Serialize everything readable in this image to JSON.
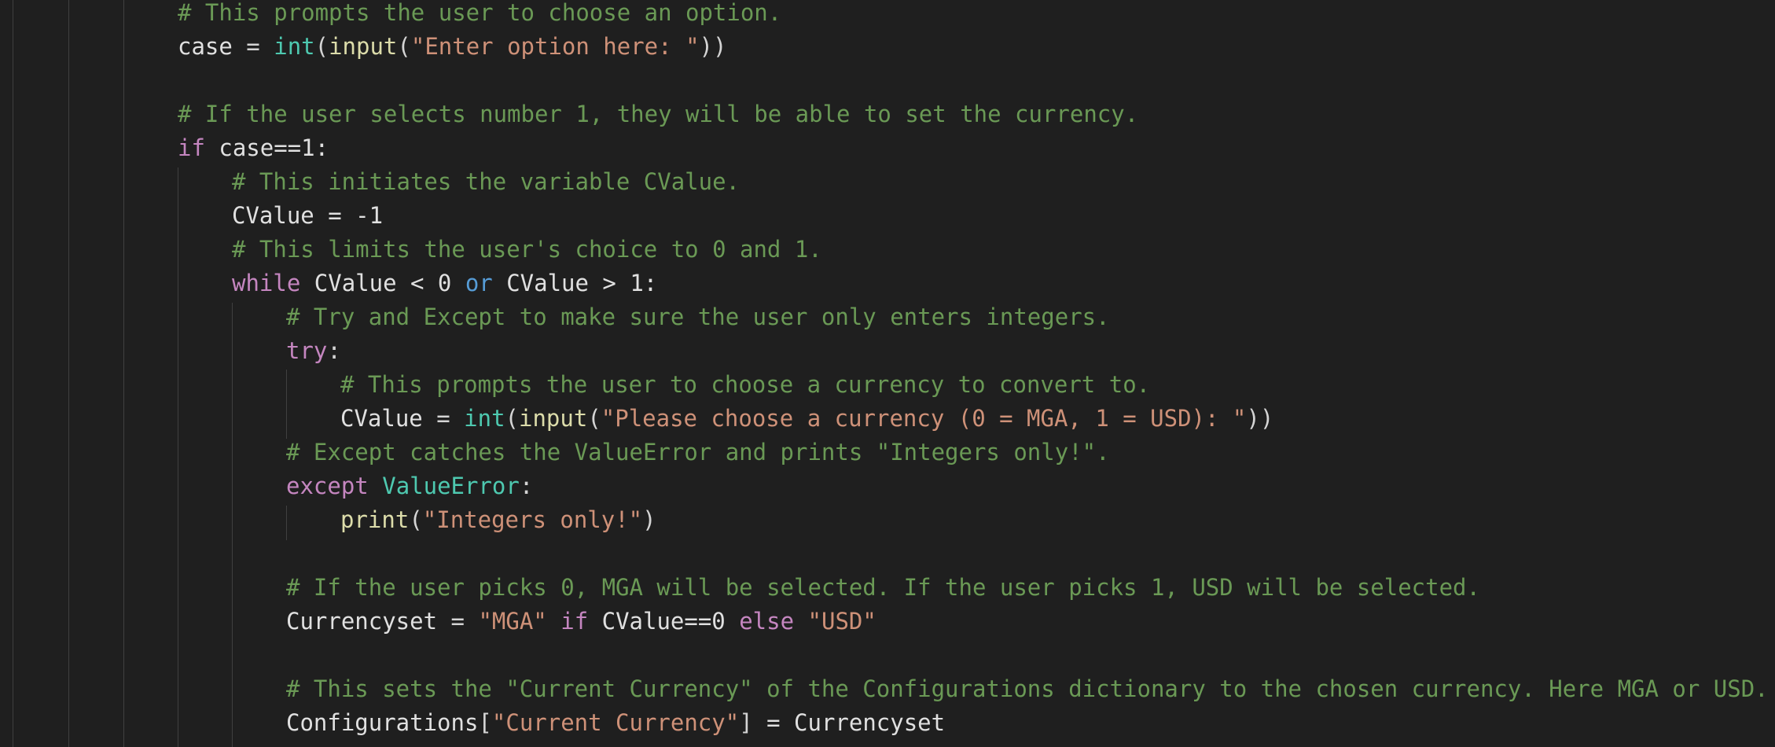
{
  "theme": {
    "background": "#1f1f1f",
    "comment": "#6a9955",
    "keyword": "#c586c0",
    "operator_keyword": "#569cd6",
    "builtin": "#4ec9b0",
    "function": "#dcdcaa",
    "string": "#ce9178",
    "number": "#b5cea8",
    "identifier": "#e0e0e0"
  },
  "code": {
    "l1_comment": "# This prompts the user to choose an option.",
    "l2_case": "case",
    "l2_eq": " = ",
    "l2_int": "int",
    "l2_p1": "(",
    "l2_input": "input",
    "l2_p2": "(",
    "l2_str": "\"Enter option here: \"",
    "l2_p3": "))",
    "l4_comment": "# If the user selects number 1, they will be able to set the currency.",
    "l5_if": "if",
    "l5_rest": " case==1:",
    "l6_comment": "# This initiates the variable CValue.",
    "l7_code": "CValue = -1",
    "l8_comment": "# This limits the user's choice to 0 and 1.",
    "l9_while": "while",
    "l9_a": " CValue < 0 ",
    "l9_or": "or",
    "l9_b": " CValue > 1:",
    "l10_comment": "# Try and Except to make sure the user only enters integers.",
    "l11_try": "try",
    "l11_colon": ":",
    "l12_comment": "# This prompts the user to choose a currency to convert to.",
    "l13_cvalue": "CValue",
    "l13_eq": " = ",
    "l13_int": "int",
    "l13_p1": "(",
    "l13_input": "input",
    "l13_p2": "(",
    "l13_str": "\"Please choose a currency (0 = MGA, 1 = USD): \"",
    "l13_p3": "))",
    "l14_comment": "# Except catches the ValueError and prints \"Integers only!\".",
    "l15_except": "except",
    "l15_sp": " ",
    "l15_valueerror": "ValueError",
    "l15_colon": ":",
    "l16_print": "print",
    "l16_p1": "(",
    "l16_str": "\"Integers only!\"",
    "l16_p2": ")",
    "l18_comment": "# If the user picks 0, MGA will be selected. If the user picks 1, USD will be selected.",
    "l19_var": "Currencyset",
    "l19_eq": " = ",
    "l19_mga": "\"MGA\"",
    "l19_sp1": " ",
    "l19_if": "if",
    "l19_cond": " CValue==0 ",
    "l19_else": "else",
    "l19_sp2": " ",
    "l19_usd": "\"USD\"",
    "l21_comment": "# This sets the \"Current Currency\" of the Configurations dictionary to the chosen currency. Here MGA or USD.",
    "l22_var": "Configurations",
    "l22_b1": "[",
    "l22_key": "\"Current Currency\"",
    "l22_b2": "]",
    "l22_rest": " = Currencyset"
  }
}
